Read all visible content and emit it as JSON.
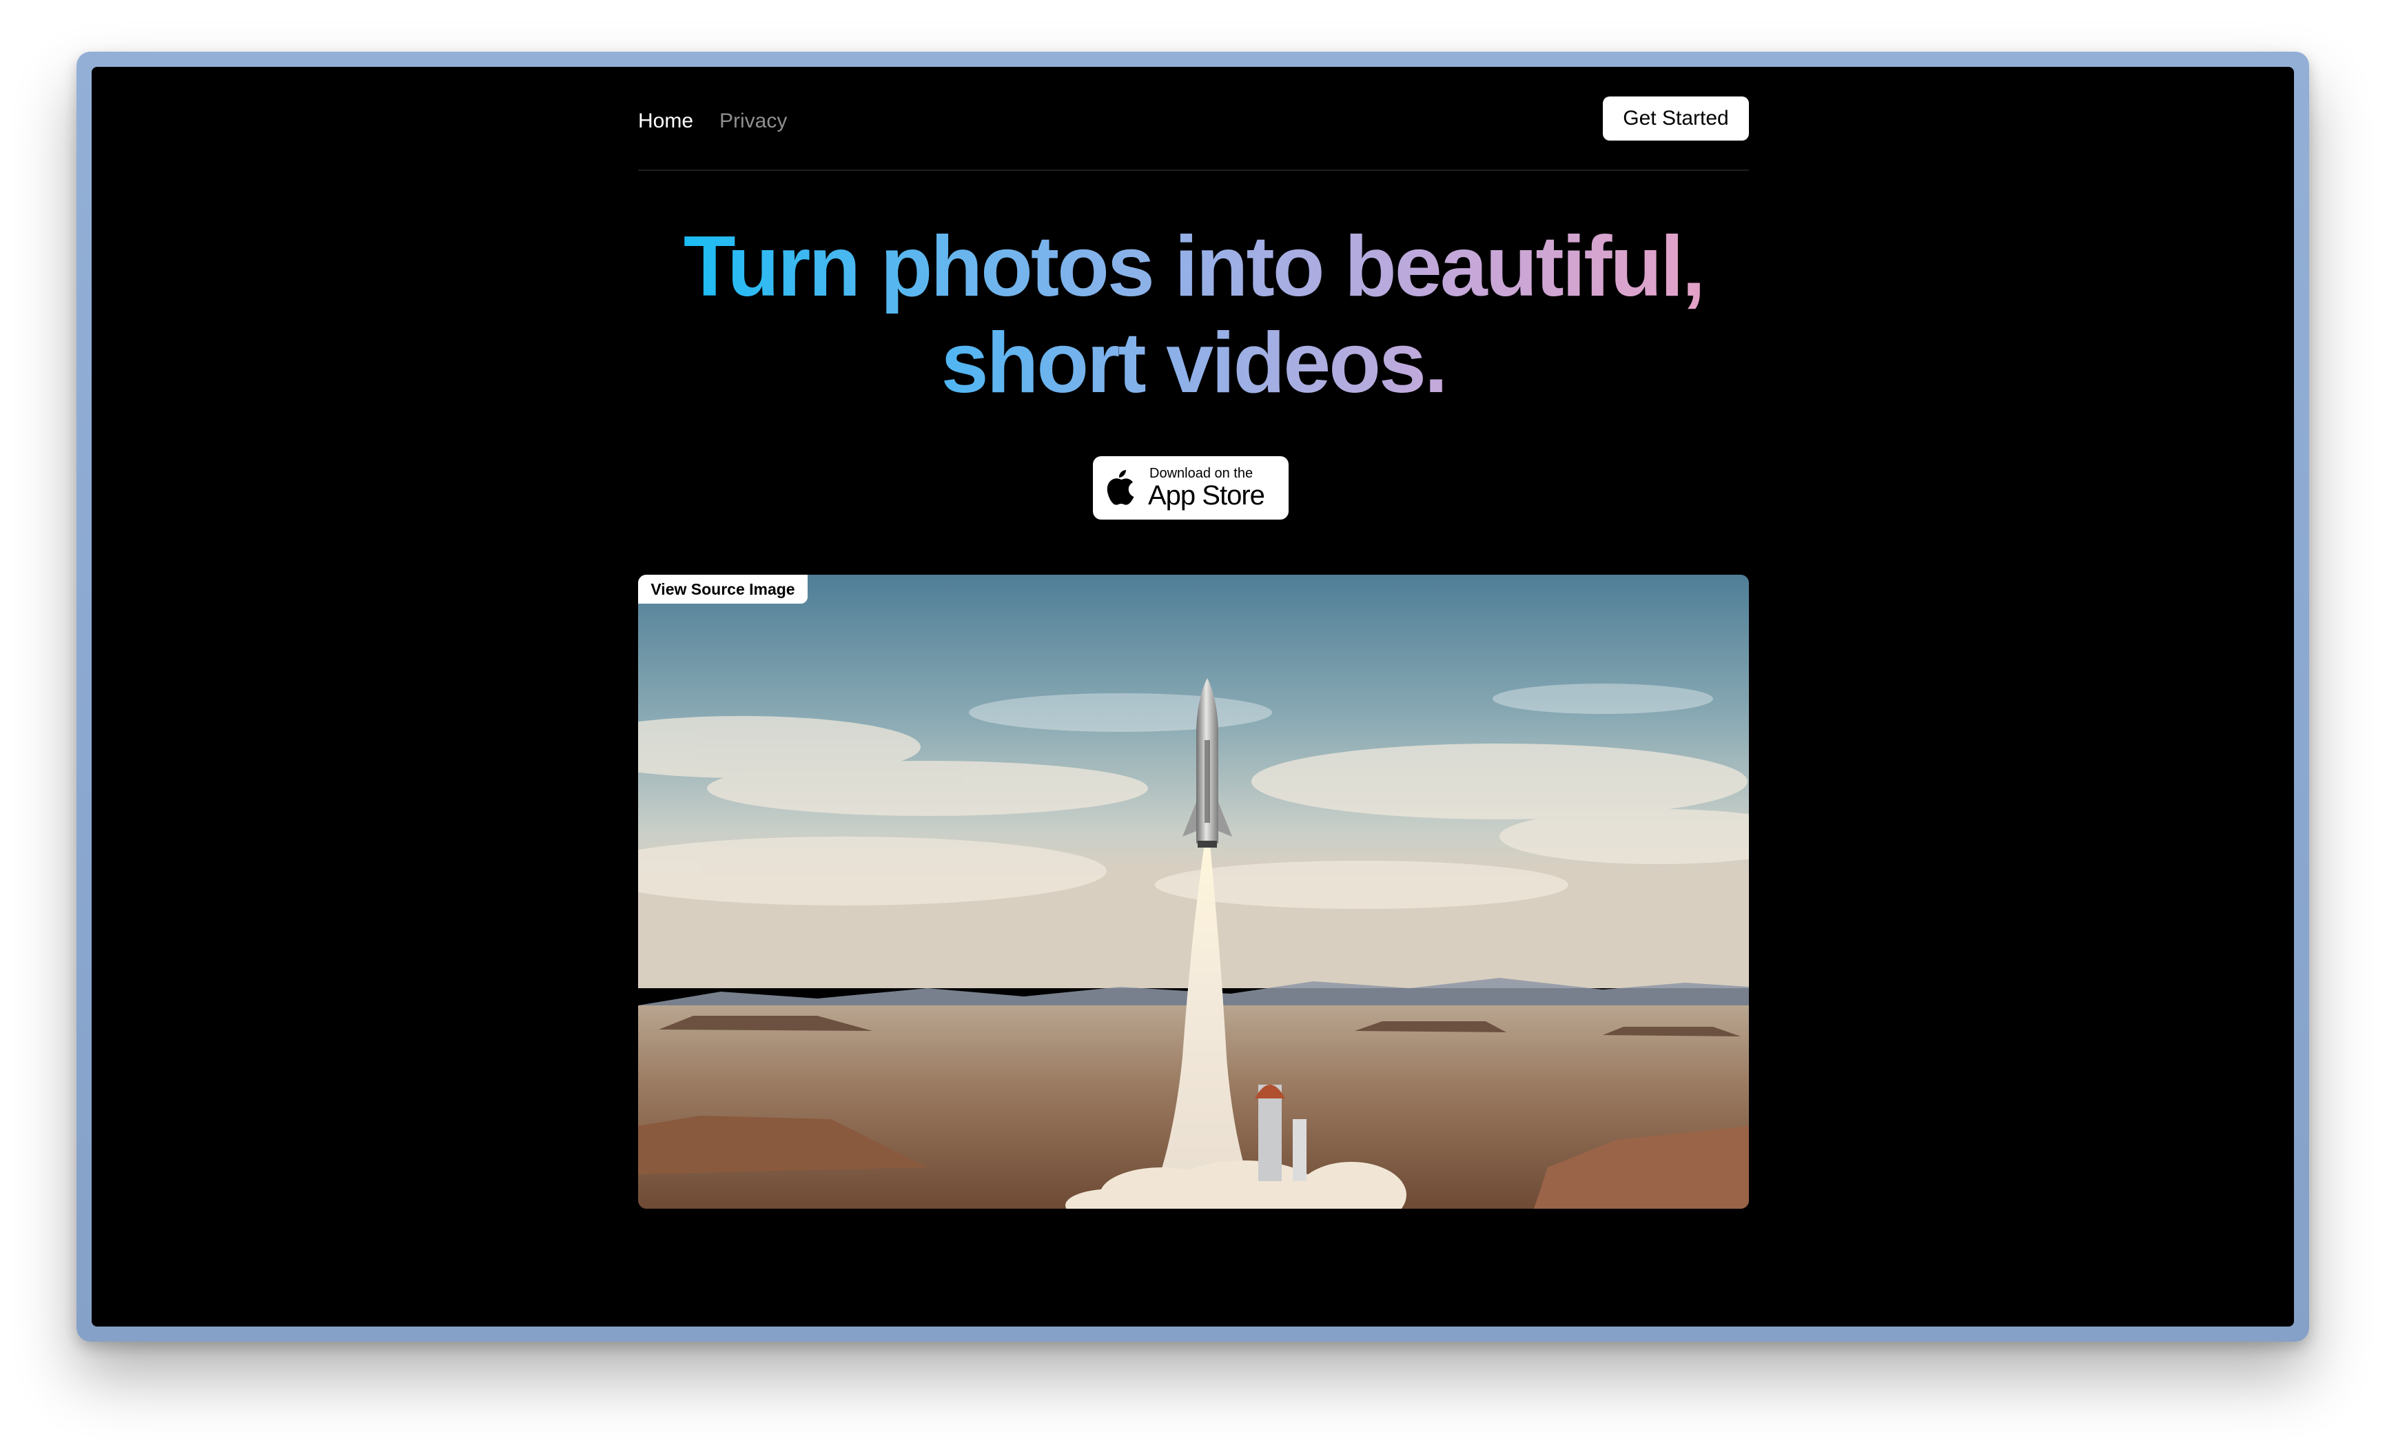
{
  "nav": {
    "links": [
      "Home",
      "Privacy"
    ],
    "active": "Home",
    "cta_label": "Get Started"
  },
  "hero": {
    "title_line_1": "Turn photos into beautiful,",
    "title_line_2": "short videos."
  },
  "app_store": {
    "small_text": "Download on the",
    "large_text": "App Store",
    "icon": "apple-icon"
  },
  "media": {
    "button_label": "View Source Image",
    "subject": "rocket-launch-desert-image"
  },
  "colors": {
    "background": "#000000",
    "nav_active": "#ffffff",
    "nav_inactive": "#8f8f8f",
    "gradient_start": "#1cbcf3",
    "gradient_end": "#e3a2c8",
    "window_frame": "#8aa7d0"
  }
}
